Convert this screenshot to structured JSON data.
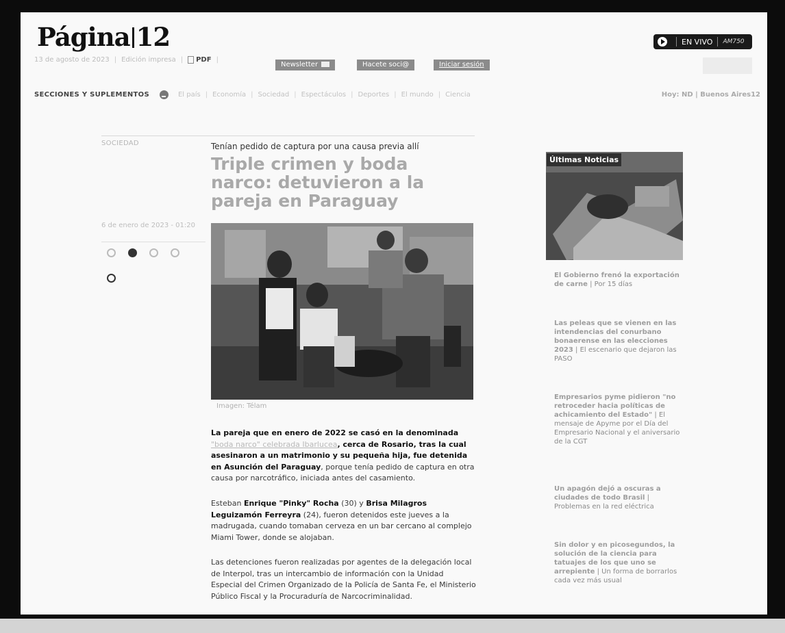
{
  "header": {
    "logo_left": "Página",
    "logo_right": "12",
    "date": "13 de agosto de 2023",
    "edition": "Edición impresa",
    "pdf": "PDF",
    "newsletter": "Newsletter",
    "subscribe": "Hacete soci@",
    "login": "Iniciar sesión",
    "live_label": "EN VIVO",
    "live_freq": "AM750",
    "search_placeholder": ""
  },
  "nav": {
    "title": "SECCIONES Y SUPLEMENTOS",
    "items": [
      "El país",
      "Economía",
      "Sociedad",
      "Espectáculos",
      "Deportes",
      "El mundo",
      "Ciencia"
    ],
    "weather": "Hoy: ND | Buenos Aires12"
  },
  "article": {
    "section": "SOCIEDAD",
    "kicker": "Tenían pedido de captura por una causa previa allí",
    "title": "Triple crimen y boda narco: detuvieron a la pareja en Paraguay",
    "date": "6 de enero de 2023 - 01:20",
    "caption": "Imagen: Télam",
    "p1_a": "La pareja que en enero de 2022 se casó en la denominada",
    "p1_link": "\"boda narco\" celebrada Ibarlucea",
    "p1_b": ", cerca de Rosario, tras la cual asesinaron a un matrimonio y su pequeña hija, fue detenida en Asunción del Paraguay",
    "p1_c": ", porque tenía pedido de captura en otra causa por narcotráfico, iniciada antes del casamiento.",
    "p2_a": "Esteban ",
    "p2_b": "Enrique \"Pinky\" Rocha",
    "p2_c": " (30) y ",
    "p2_d": "Brisa Milagros Leguizamón Ferreyra",
    "p2_e": " (24), fueron detenidos este jueves a la madrugada, cuando tomaban cerveza en un bar cercano al complejo Miami Tower, donde se alojaban.",
    "p3": "Las detenciones fueron realizadas por agentes de la delegación local de Interpol, tras un intercambio de información con la Unidad Especial del Crimen Organizado de la Policía de Santa Fe, el Ministerio Público Fiscal y la Procuraduría de Narcocriminalidad."
  },
  "sidebar": {
    "label": "Últimas Noticias",
    "news": [
      {
        "headline": "El Gobierno frenó la exportación de carne",
        "desc": " | Por 15 días"
      },
      {
        "headline": "Las peleas que se vienen en las intendencias del conurbano bonaerense en las elecciones 2023",
        "desc": " | El escenario que dejaron las PASO"
      },
      {
        "headline": "Empresarios pyme pidieron \"no retroceder hacia políticas de achicamiento del Estado\"",
        "desc": " | El mensaje de Apyme por el Día del Empresario Nacional y el aniversario de la CGT"
      },
      {
        "headline": "Un apagón dejó a oscuras a ciudades de todo Brasil",
        "desc": " | Problemas en la red eléctrica"
      },
      {
        "headline": "Sin dolor y en picosegundos, la solución de la ciencia para tatuajes de los que uno se arrepiente",
        "desc": " | Un forma de borrarlos cada vez más usual"
      }
    ]
  }
}
